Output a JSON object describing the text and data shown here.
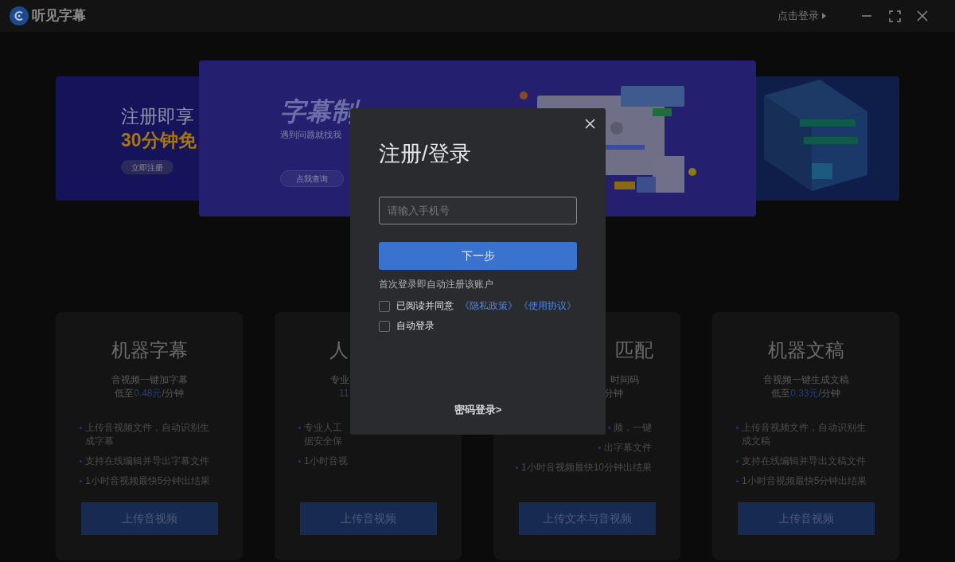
{
  "app": {
    "name": "听见字幕",
    "login_link": "点击登录"
  },
  "banners": {
    "left": {
      "line_1": "注册即享",
      "line_2": "30分钟免",
      "button": "立即注册"
    },
    "center": {
      "title": "字幕制",
      "subtitle": "遇到问题就找我",
      "button": "点我查询"
    }
  },
  "cards": [
    {
      "title": "机器字幕",
      "subtitle": "音视频一键加字幕",
      "price_prefix": "低至",
      "price_value": "0.48元",
      "price_suffix": "/分钟",
      "features": [
        "上传音视频文件，自动识别生成字幕",
        "支持在线编辑并导出字幕文件",
        "1小时音视频最快5分钟出结果"
      ],
      "button": "上传音视频"
    },
    {
      "title": "人",
      "subtitle": "专业",
      "price_value": "11",
      "features": [
        "专业人工据安全保",
        "1小时音视"
      ],
      "button": "上传音视频"
    },
    {
      "title": "匹配",
      "subtitle": "时间码",
      "price_suffix": "分钟",
      "features": [
        "频，一键",
        "出字幕文件",
        "1小时音视频最快10分钟出结果"
      ],
      "button": "上传文本与音视频"
    },
    {
      "title": "机器文稿",
      "subtitle": "音视频一键生成文稿",
      "price_prefix": "低至",
      "price_value": "0.33元",
      "price_suffix": "/分钟",
      "features": [
        "上传音视频文件，自动识别生成文稿",
        "支持在线编辑并导出文稿文件",
        "1小时音视频最快5分钟出结果"
      ],
      "button": "上传音视频"
    }
  ],
  "dialog": {
    "title": "注册/登录",
    "phone_field": {
      "placeholder": "请输入手机号"
    },
    "next_button": "下一步",
    "hint": "首次登录即自动注册该账户",
    "agree": {
      "label": "已阅读并同意",
      "checked": false,
      "links": [
        "《隐私政策》",
        "《使用协议》"
      ]
    },
    "auto_login": {
      "label": "自动登录",
      "checked": false
    },
    "password_login": "密码登录>"
  }
}
